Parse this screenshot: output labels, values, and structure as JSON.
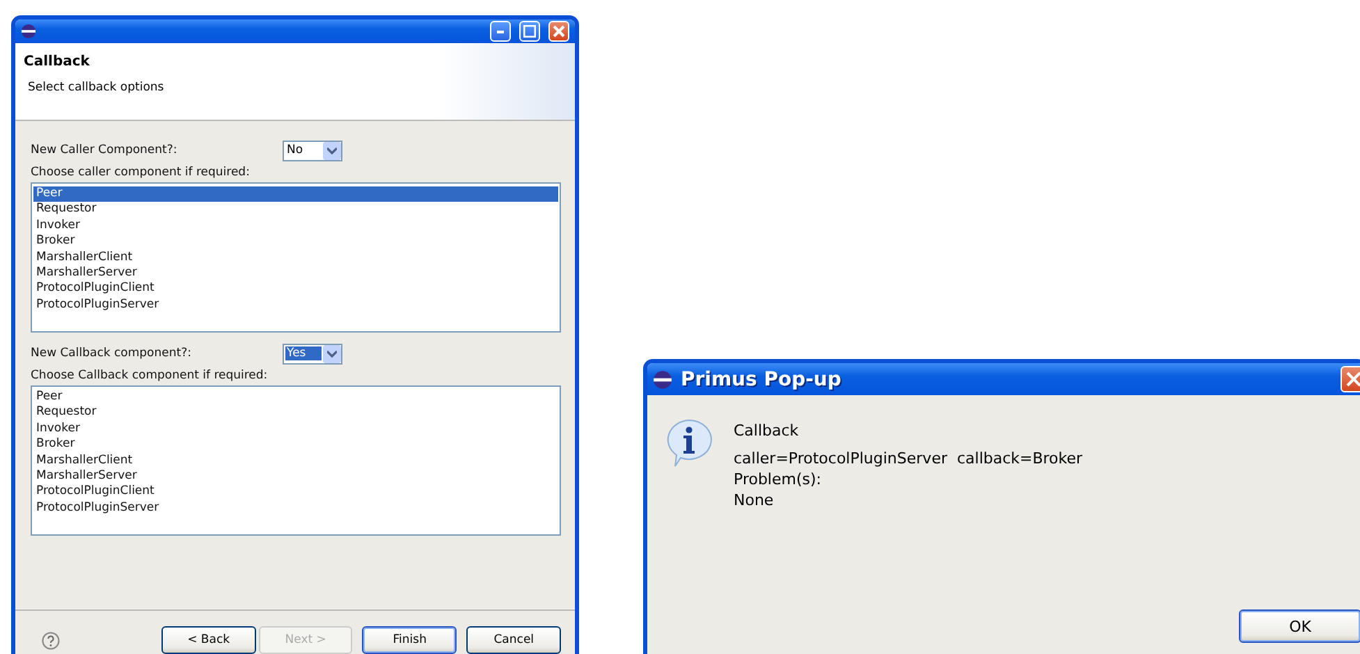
{
  "wizard": {
    "header": {
      "title": "Callback",
      "subtitle": "Select callback options"
    },
    "sections": [
      {
        "question": "New Caller Component?:",
        "combo": {
          "value": "No",
          "focused": false
        },
        "list_label": "Choose caller component if required:",
        "items": [
          {
            "label": "Peer",
            "selected": true
          },
          {
            "label": "Requestor",
            "selected": false
          },
          {
            "label": "Invoker",
            "selected": false
          },
          {
            "label": "Broker",
            "selected": false
          },
          {
            "label": "MarshallerClient",
            "selected": false
          },
          {
            "label": "MarshallerServer",
            "selected": false
          },
          {
            "label": "ProtocolPluginClient",
            "selected": false
          },
          {
            "label": "ProtocolPluginServer",
            "selected": false
          }
        ]
      },
      {
        "question": "New Callback component?:",
        "combo": {
          "value": "Yes",
          "focused": true
        },
        "list_label": "Choose Callback component if required:",
        "items": [
          {
            "label": "Peer",
            "selected": false
          },
          {
            "label": "Requestor",
            "selected": false
          },
          {
            "label": "Invoker",
            "selected": false
          },
          {
            "label": "Broker",
            "selected": false
          },
          {
            "label": "MarshallerClient",
            "selected": false
          },
          {
            "label": "MarshallerServer",
            "selected": false
          },
          {
            "label": "ProtocolPluginClient",
            "selected": false
          },
          {
            "label": "ProtocolPluginServer",
            "selected": false
          }
        ]
      }
    ],
    "buttons": [
      {
        "label": "< Back",
        "disabled": false,
        "default": false
      },
      {
        "label": "Next >",
        "disabled": true,
        "default": false
      },
      {
        "label": "Finish",
        "disabled": false,
        "default": true
      },
      {
        "label": "Cancel",
        "disabled": false,
        "default": false
      }
    ]
  },
  "popup": {
    "title": "Primus Pop-up",
    "heading": "Callback",
    "lines": [
      "caller=ProtocolPluginServer  callback=Broker",
      "Problem(s):",
      "None"
    ],
    "buttons": [
      {
        "label": "OK",
        "disabled": false,
        "default": true
      }
    ]
  }
}
